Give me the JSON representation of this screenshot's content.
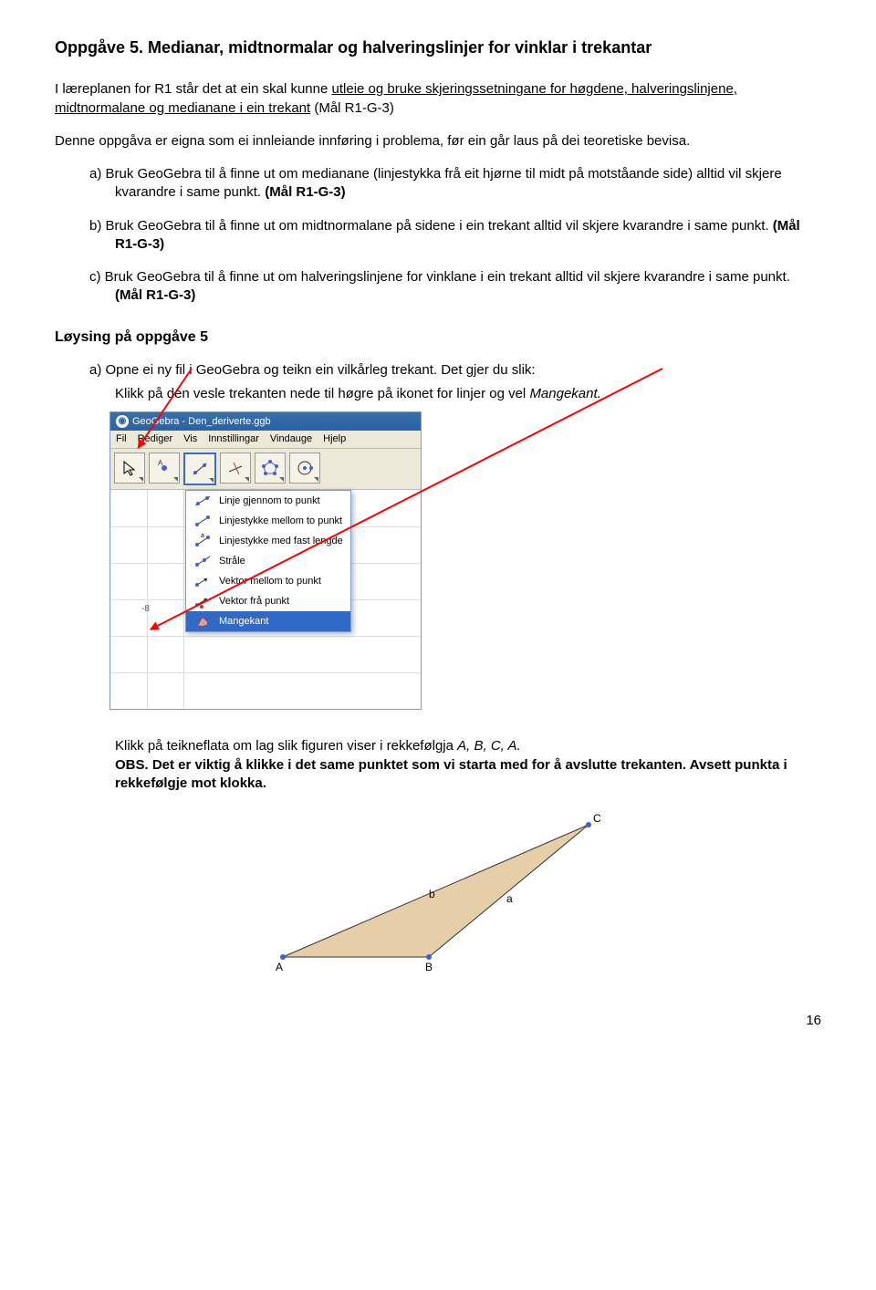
{
  "title_prefix": "Oppgåve 5.",
  "title_rest": "Medianar, midtnormalar og halveringslinjer for vinklar i trekantar",
  "intro_1": "I  læreplanen for R1 står det at ein skal kunne ",
  "intro_u": "utleie og bruke skjeringssetningane for høgdene, halveringslinjene, midtnormalane og medianane i ein trekant",
  "intro_2": " (Mål R1-G-3)",
  "para2": "Denne oppgåva er eigna som ei innleiande innføring i problema, før ein går laus på dei teoretiske bevisa.",
  "a_txt": "a) Bruk GeoGebra til å finne ut om medianane (linjestykka frå eit hjørne til midt på motståande side) alltid vil skjere kvarandre i same punkt. ",
  "a_bold": "(Mål R1-G-3)",
  "b_txt": "b) Bruk GeoGebra til å finne ut om midtnormalane på sidene i ein trekant alltid vil skjere kvarandre i same punkt. ",
  "b_bold": "(Mål R1-G-3)",
  "c_txt": "c) Bruk GeoGebra til å finne ut om halveringslinjene for vinklane i ein trekant alltid vil skjere kvarandre i same punkt. ",
  "c_bold": "(Mål R1-G-3)",
  "loysing_h": "Løysing på oppgåve 5",
  "sol_a1": "a)  Opne ei ny fil i GeoGebra og teikn ein vilkårleg trekant. Det gjer du slik:",
  "sol_a2_1": "Klikk på den vesle trekanten nede til høgre på ikonet for linjer og vel ",
  "sol_a2_i": "Mangekant.",
  "gg": {
    "title": "GeoGebra - Den_deriverte.ggb",
    "menu": [
      "Fil",
      "Rediger",
      "Vis",
      "Innstillingar",
      "Vindauge",
      "Hjelp"
    ],
    "dropdown": [
      "Linje gjennom to punkt",
      "Linjestykke mellom to punkt",
      "Linjestykke med fast lengde",
      "Stråle",
      "Vektor mellom to punkt",
      "Vektor frå punkt",
      "Mangekant"
    ],
    "axis_x": "-8"
  },
  "below1_1": "Klikk på teikneflata om lag slik figuren viser i rekkefølgja ",
  "below1_i": "A, B, C, A.",
  "below2": "OBS. Det er viktig å klikke i det same punktet som vi starta med for å avslutte trekanten. Avsett punkta i rekkefølgje mot klokka.",
  "tri_labels": {
    "A": "A",
    "B": "B",
    "C": "C",
    "a": "a",
    "b": "b"
  },
  "page_num": "16"
}
